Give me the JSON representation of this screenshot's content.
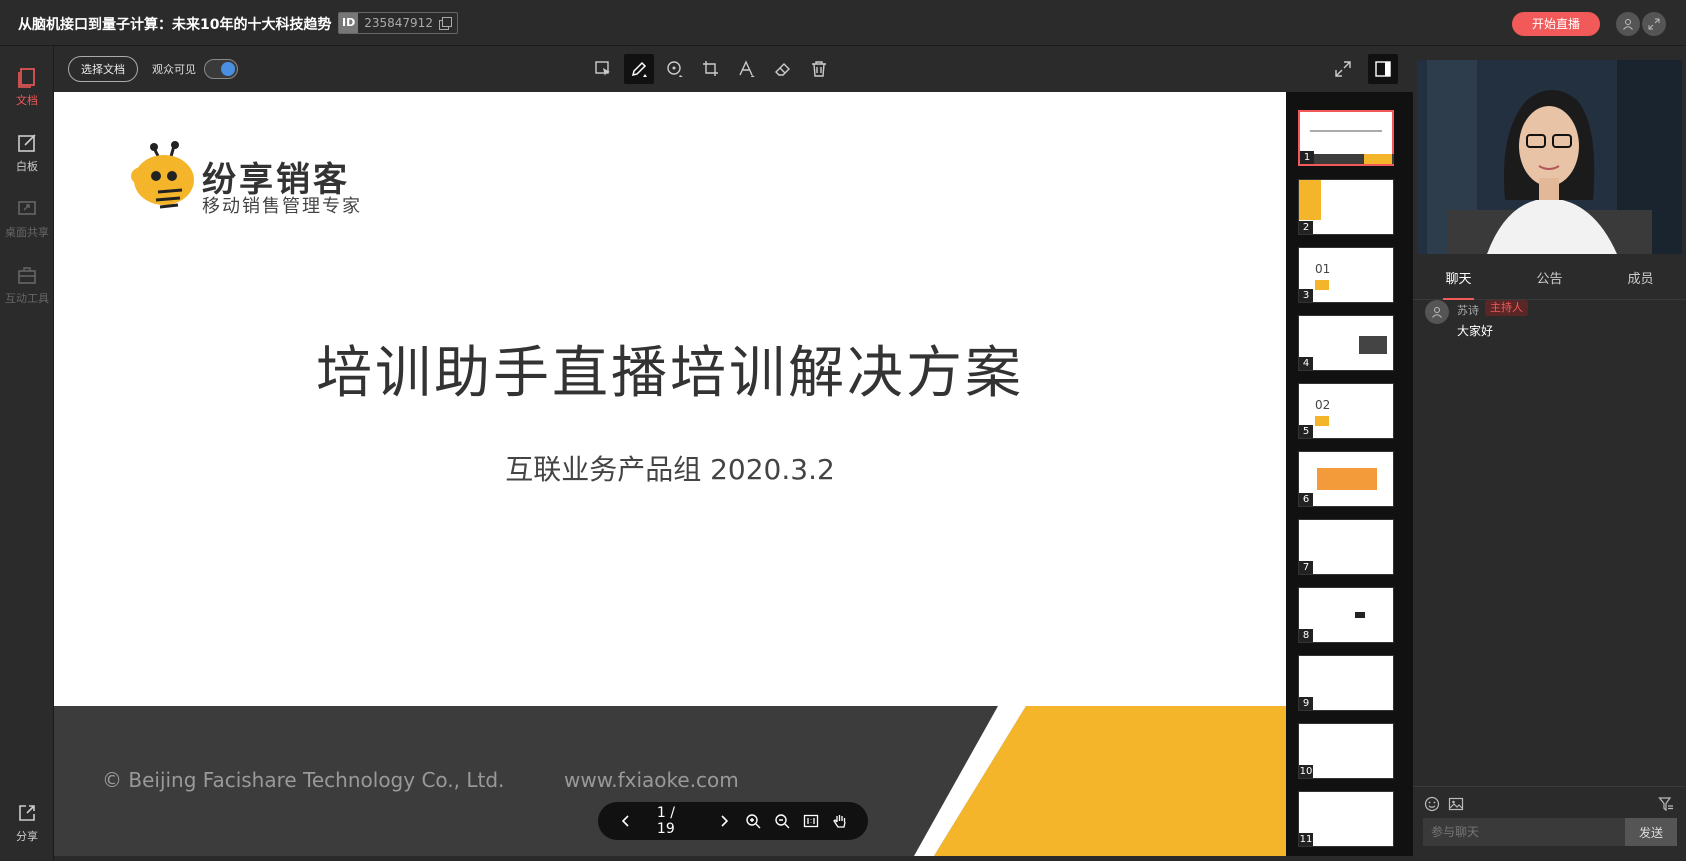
{
  "header": {
    "title": "从脑机接口到量子计算：未来10年的十大科技趋势",
    "id_label": "ID",
    "id_value": "235847912",
    "live_button": "开始直播"
  },
  "sidebar": {
    "items": [
      {
        "label": "文档",
        "icon": "document-icon",
        "active": true
      },
      {
        "label": "白板",
        "icon": "whiteboard-icon"
      },
      {
        "label": "桌面共享",
        "icon": "screen-share-icon"
      },
      {
        "label": "互动工具",
        "icon": "toolbox-icon"
      },
      {
        "label": "分享",
        "icon": "share-icon"
      }
    ]
  },
  "toolbar": {
    "select_doc": "选择文档",
    "audience_visible": "观众可见",
    "audience_visible_on": true,
    "tools": [
      "select-icon",
      "pen-icon",
      "shape-circle-icon",
      "crop-icon",
      "text-icon",
      "eraser-icon",
      "trash-icon"
    ],
    "active_tool": "pen-icon"
  },
  "slide": {
    "brand": "纷享销客",
    "brand_sub": "移动销售管理专家",
    "title": "培训助手直播培训解决方案",
    "subtitle": "互联业务产品组  2020.3.2",
    "copyright": "© Beijing Facishare Technology Co., Ltd.",
    "website": "www.fxiaoke.com"
  },
  "pager": {
    "current": 1,
    "total": 19,
    "text": "1 / 19"
  },
  "thumbnails": [
    "1",
    "2",
    "3",
    "4",
    "5",
    "6",
    "7",
    "8",
    "9",
    "10",
    "11"
  ],
  "thumb_labels": {
    "t3": "01",
    "t5": "02"
  },
  "chat": {
    "tabs": [
      "聊天",
      "公告",
      "成员"
    ],
    "messages": [
      {
        "name": "苏诗",
        "badge": "主持人",
        "text": "大家好"
      }
    ],
    "input_placeholder": "参与聊天",
    "send": "发送"
  },
  "colors": {
    "accent": "#f25a5a",
    "brand_yellow": "#f5b52a",
    "toggle_on": "#4a90e2"
  }
}
